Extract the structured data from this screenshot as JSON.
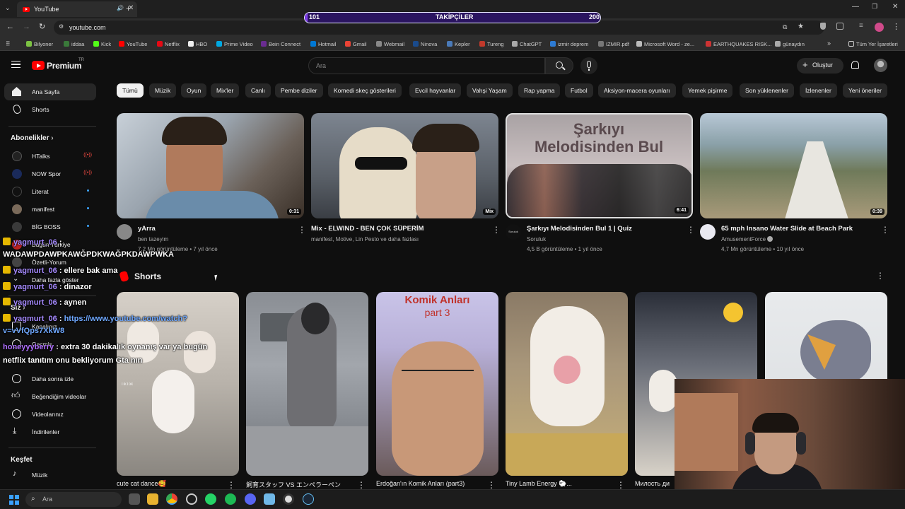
{
  "browser": {
    "tab_title": "YouTube",
    "new_tab": "+",
    "url": "youtube.com",
    "bookmarks": [
      "Bilyoner",
      "iddaa",
      "Kick",
      "YouTube",
      "Netflix",
      "HBO",
      "Prime Video",
      "Bein Connect",
      "Hotmail",
      "Gmail",
      "Webmail",
      "Ninova",
      "Kepler",
      "Tureng",
      "ChatGPT",
      "izmir deprem",
      "IZMIR.pdf",
      "Microsoft Word - ze...",
      "EARTHQUAKES RISK...",
      "günaydın"
    ],
    "all_bookmarks": "Tüm Yer İşaretleri"
  },
  "followers_bar": {
    "label": "TAKİPÇİLER",
    "current": "101",
    "goal": "200",
    "progress_fraction": 0.01
  },
  "header": {
    "logo": "Premium",
    "logo_sup": "TR",
    "search_placeholder": "Ara",
    "create_label": "Oluştur"
  },
  "chips": [
    "Tümü",
    "Müzik",
    "Oyun",
    "Mix'ler",
    "Canlı",
    "Pembe diziler",
    "Komedi skeç gösterileri",
    "Evcil hayvanlar",
    "Vahşi Yaşam",
    "Rap yapma",
    "Futbol",
    "Aksiyon-macera oyunları",
    "Yemek pişirme",
    "Son yüklenenler",
    "İzlenenler",
    "Yeni öneriler"
  ],
  "sidebar": {
    "home": "Ana Sayfa",
    "shorts": "Shorts",
    "subs_title": "Abonelikler",
    "subs": [
      {
        "name": "HTalks",
        "live": "((•))"
      },
      {
        "name": "NOW Spor",
        "live": "((•))"
      },
      {
        "name": "Literat"
      },
      {
        "name": "manifest"
      },
      {
        "name": "BİG BOSS"
      },
      {
        "name": "Bugün Türkiye"
      },
      {
        "name": "Özetli-Yorum"
      }
    ],
    "more": "Daha fazla göster",
    "you_title": "Siz",
    "you_items": [
      "Kanalınız",
      "Geçmiş",
      "Daha sonra izle",
      "Beğendiğim videolar",
      "Videolarınız",
      "İndirilenler"
    ],
    "explore_title": "Keşfet",
    "explore_items": [
      "Müzik"
    ]
  },
  "videos": [
    {
      "title": "yArra",
      "channel": "ben tazeyim",
      "meta": "7,2 Mn görüntüleme • 7 yıl önce",
      "duration": "0:31"
    },
    {
      "title": "Mix - ELWIND - BEN ÇOK SÜPERİM",
      "channel": "manifest, Motive, Lin Pesto ve daha fazlası",
      "meta": "",
      "duration": "Mix"
    },
    {
      "title": "Şarkıyı Melodisinden Bul 1 | Quiz",
      "channel": "Soruluk",
      "meta": "4,5 B görüntüleme • 1 yıl önce",
      "duration": "6:41",
      "thumb_text": "Şarkıyı Melodisinden Bul",
      "avatar_text": "Soruluk"
    },
    {
      "title": "65 mph Insano Water Slide at Beach Park",
      "channel": "AmusementForce",
      "meta": "4,7 Mn görüntüleme • 10 yıl önce",
      "duration": "0:39"
    }
  ],
  "shorts_section": {
    "title": "Shorts",
    "items": [
      {
        "title": "cute cat dance🥰",
        "thumb_text": "TikTok"
      },
      {
        "title": "飼育スタッフ VS エンペラーペン"
      },
      {
        "title": "Erdoğan'ın Komik Anları (part3)",
        "thumb_text": "Komik Anları",
        "thumb_sub": "part 3"
      },
      {
        "title": "Tiny Lamb Energy 🐑..."
      },
      {
        "title": "Милость ди"
      },
      {
        "title": ""
      }
    ]
  },
  "chat": [
    {
      "user": "yagmurt_06",
      "text": ":",
      "cont": "WADAWPDAWPKAWĞPDKWAĞPKDAWPWKA"
    },
    {
      "user": "yagmurt_06",
      "text": ": ellere bak ama"
    },
    {
      "user": "yagmurt_06",
      "text": ": dinazor"
    },
    {
      "user": "yagmurt_06",
      "text": ": aynen"
    },
    {
      "user": "yagmurt_06",
      "text": ": ",
      "link": "https://www.youtube.com/watch?",
      "cont": "v=vVfQps7XkW8"
    },
    {
      "user": "honeyyyberry",
      "text": ": extra 30 dakikalık oynanış var ya bugün",
      "cont": "netflix tanıtım onu bekliyorum Gta nın"
    }
  ],
  "taskbar": {
    "search": "Ara"
  },
  "colors": {
    "bg": "#0f0f0f",
    "chip": "#272727",
    "accent_red": "#ff0000",
    "follow_bar": "#6d2bd9"
  }
}
